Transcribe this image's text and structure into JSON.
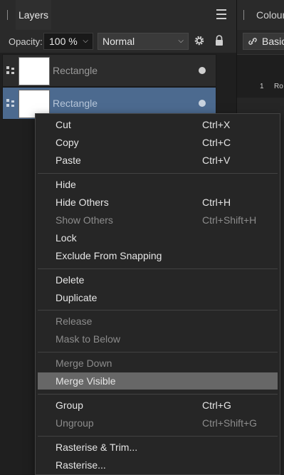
{
  "tabs": {
    "layers": "Layers",
    "colour": "Colour"
  },
  "toolbar": {
    "opacity_label": "Opacity:",
    "opacity_value": "100 %",
    "blend_mode": "Normal"
  },
  "right_panel": {
    "basic": "Basic",
    "swatch_number": "1",
    "swatch_text": "Ro"
  },
  "layers": [
    {
      "name": "Rectangle",
      "selected": false
    },
    {
      "name": "Rectangle",
      "selected": true
    }
  ],
  "context_menu": {
    "cut": {
      "label": "Cut",
      "shortcut": "Ctrl+X"
    },
    "copy": {
      "label": "Copy",
      "shortcut": "Ctrl+C"
    },
    "paste": {
      "label": "Paste",
      "shortcut": "Ctrl+V"
    },
    "hide": {
      "label": "Hide"
    },
    "hide_others": {
      "label": "Hide Others",
      "shortcut": "Ctrl+H"
    },
    "show_others": {
      "label": "Show Others",
      "shortcut": "Ctrl+Shift+H"
    },
    "lock": {
      "label": "Lock"
    },
    "exclude_snapping": {
      "label": "Exclude From Snapping"
    },
    "delete": {
      "label": "Delete"
    },
    "duplicate": {
      "label": "Duplicate"
    },
    "release": {
      "label": "Release"
    },
    "mask_below": {
      "label": "Mask to Below"
    },
    "merge_down": {
      "label": "Merge Down"
    },
    "merge_visible": {
      "label": "Merge Visible"
    },
    "group": {
      "label": "Group",
      "shortcut": "Ctrl+G"
    },
    "ungroup": {
      "label": "Ungroup",
      "shortcut": "Ctrl+Shift+G"
    },
    "rasterise_trim": {
      "label": "Rasterise & Trim..."
    },
    "rasterise": {
      "label": "Rasterise..."
    }
  },
  "colors": {
    "selection": "#4c6a8f",
    "menu_highlight": "#676767",
    "menu_bg": "#262626"
  }
}
